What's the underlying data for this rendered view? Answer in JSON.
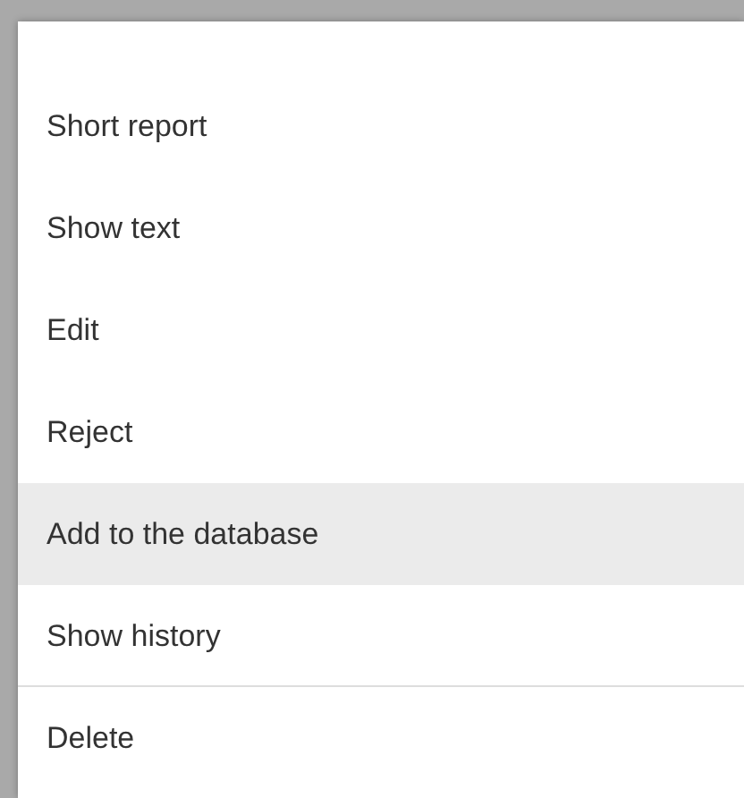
{
  "menu": {
    "groups": [
      [
        {
          "label": "Short report",
          "selected": false
        },
        {
          "label": "Show text",
          "selected": false
        },
        {
          "label": "Edit",
          "selected": false
        },
        {
          "label": "Reject",
          "selected": false
        },
        {
          "label": "Add to the database",
          "selected": true
        },
        {
          "label": "Show history",
          "selected": false
        }
      ],
      [
        {
          "label": "Delete",
          "selected": false
        }
      ]
    ]
  }
}
